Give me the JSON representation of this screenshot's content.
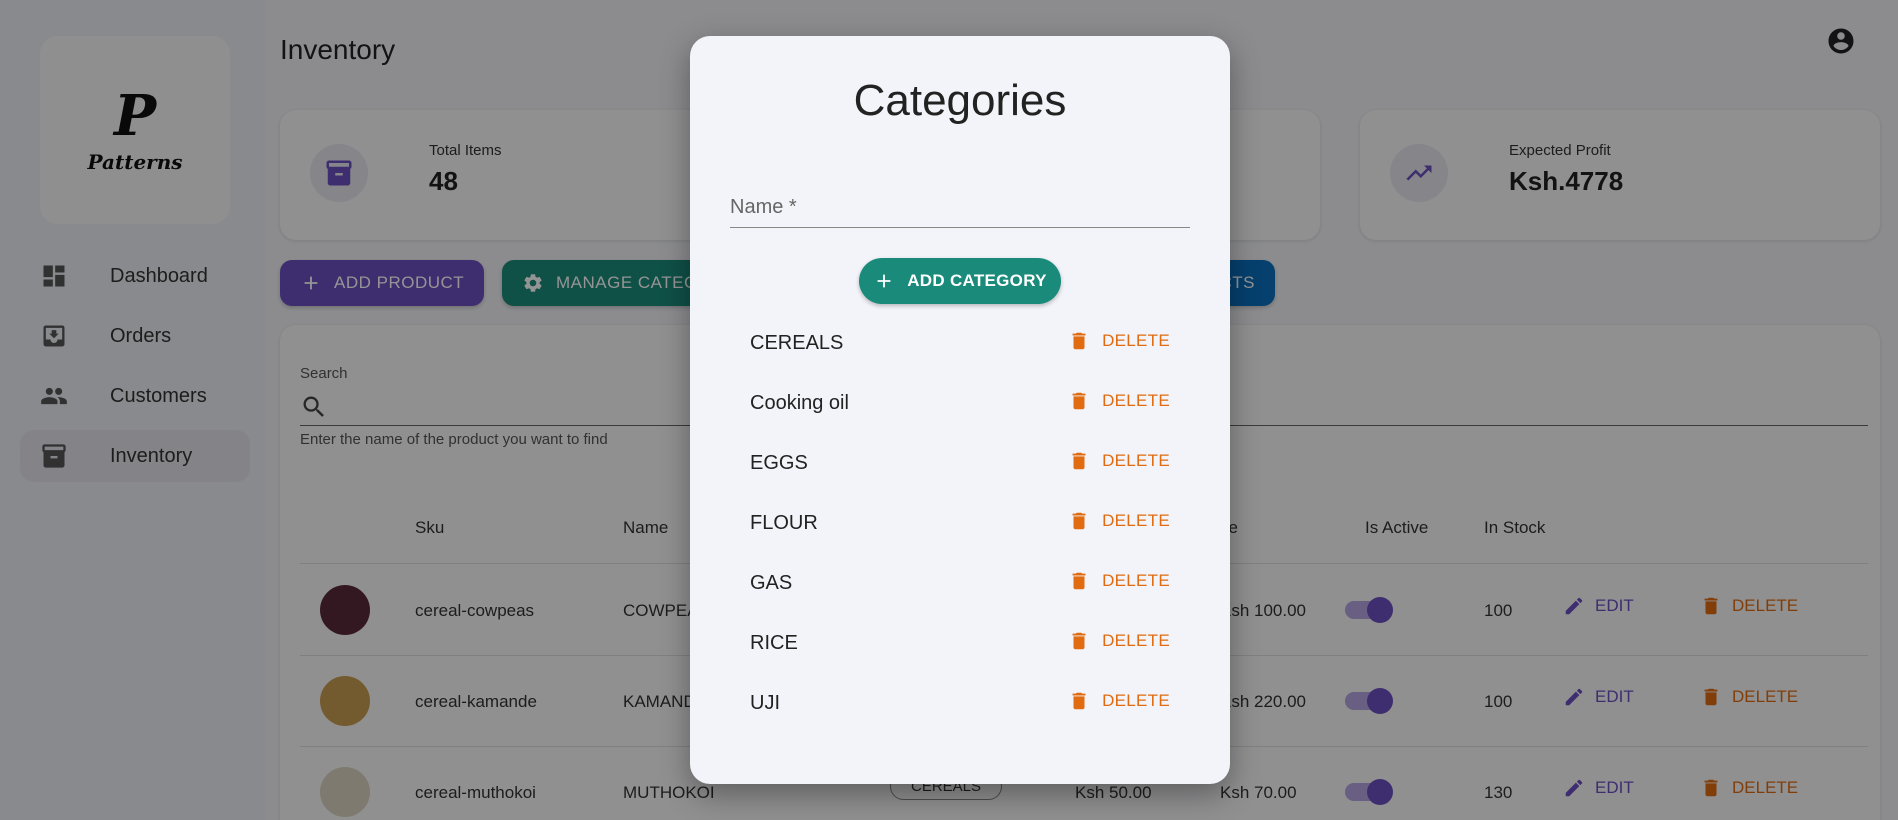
{
  "sidebar": {
    "logo": {
      "letter": "P",
      "name": "Patterns"
    },
    "items": [
      {
        "label": "Dashboard",
        "icon": "dashboard-icon"
      },
      {
        "label": "Orders",
        "icon": "orders-icon"
      },
      {
        "label": "Customers",
        "icon": "customers-icon"
      },
      {
        "label": "Inventory",
        "icon": "inventory-icon",
        "active": true
      }
    ]
  },
  "header": {
    "title": "Inventory",
    "account_icon": "account-circle-icon"
  },
  "stats": [
    {
      "label": "Total Items",
      "value": "48",
      "icon": "archive-icon"
    },
    {
      "label": "Expected Profit",
      "value": "Ksh.4778",
      "icon": "trending-up-icon"
    }
  ],
  "toolbar": {
    "add_product": "ADD PRODUCT",
    "manage_categories": "MANAGE CATEG",
    "third_button_partial": "CTS"
  },
  "search": {
    "label": "Search",
    "helper": "Enter the name of the product you want to find"
  },
  "table": {
    "headers": {
      "sku": "Sku",
      "name": "Name",
      "price": "ce",
      "is_active": "Is Active",
      "in_stock": "In Stock"
    },
    "edit_label": "EDIT",
    "delete_label": "DELETE",
    "rows": [
      {
        "sku": "cereal-cowpeas",
        "name": "COWPEA",
        "category": "",
        "buy_price": "",
        "price": "Ksh 100.00",
        "in_stock": "100",
        "active": true,
        "thumb_color": "#5a2a3a"
      },
      {
        "sku": "cereal-kamande",
        "name": "KAMAND",
        "category": "",
        "buy_price": "",
        "price": "Ksh 220.00",
        "in_stock": "100",
        "active": true,
        "thumb_color": "#c89b52"
      },
      {
        "sku": "cereal-muthokoi",
        "name": "MUTHOKOI",
        "category": "CEREALS",
        "buy_price": "Ksh 50.00",
        "price": "Ksh 70.00",
        "in_stock": "130",
        "active": true,
        "thumb_color": "#d9d2c0"
      }
    ]
  },
  "modal": {
    "title": "Categories",
    "name_placeholder": "Name *",
    "add_button": "ADD CATEGORY",
    "delete_label": "DELETE",
    "categories": [
      "CEREALS",
      "Cooking oil",
      "EGGS",
      "FLOUR",
      "GAS",
      "RICE",
      "UJI"
    ]
  },
  "colors": {
    "primary": "#6b4fbf",
    "teal": "#1a8a7a",
    "blue": "#0a6ebd",
    "delete": "#e06b10",
    "overlay": "rgba(0,0,0,0.42)"
  }
}
